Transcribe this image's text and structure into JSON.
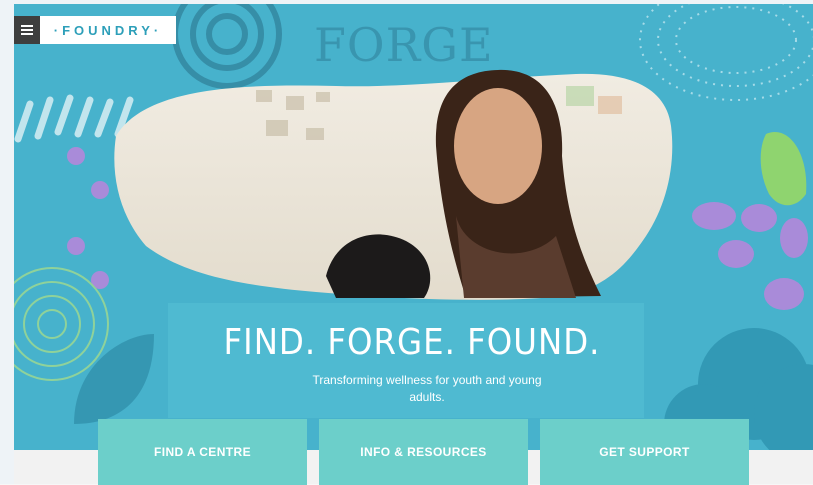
{
  "header": {
    "menu_icon": "hamburger-icon",
    "logo_text": "·FOUNDRY·",
    "background_word": "FORGE"
  },
  "hero": {
    "headline": "FIND. FORGE. FOUND.",
    "subtitle": "Transforming wellness for youth and young adults."
  },
  "cta": {
    "find_centre": "FIND A CENTRE",
    "info_resources": "INFO & RESOURCES",
    "get_support": "GET SUPPORT"
  },
  "colors": {
    "hero_background": "#47b2cc",
    "cta_background": "#6ccfca",
    "menu_background": "#3e3e3e",
    "logo_text": "#2d9fb9"
  }
}
